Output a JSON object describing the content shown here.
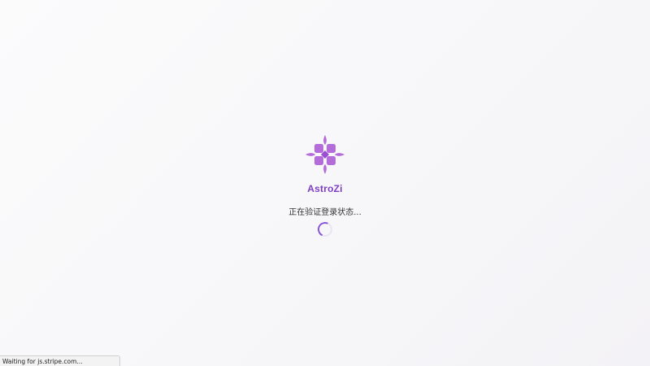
{
  "app": {
    "name": "AstroZi",
    "logo_icon": "astrozi-flower-logo-icon",
    "accent_color": "#7e3fc6",
    "logo_color": "#b36cd9"
  },
  "loading": {
    "status_text": "正在验证登录状态...",
    "spinner_icon": "loading-spinner-icon"
  },
  "browser": {
    "status_bar_text": "Waiting for js.stripe.com..."
  }
}
